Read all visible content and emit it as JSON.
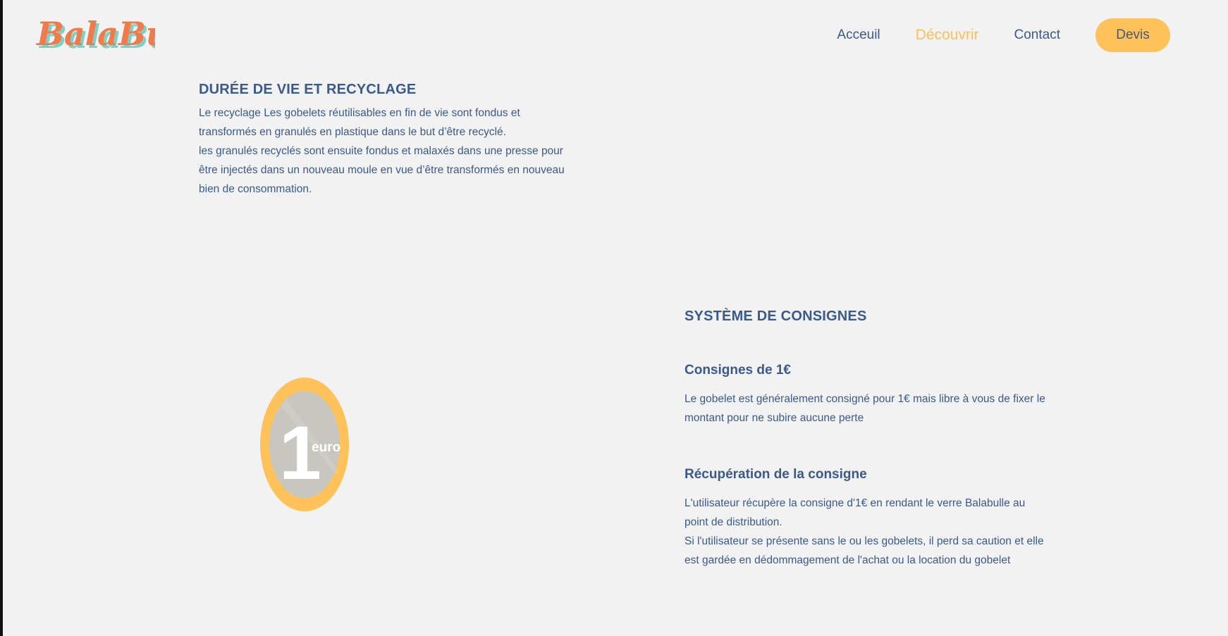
{
  "brand": {
    "logo_text": "BalaBulle"
  },
  "nav": {
    "items": [
      {
        "label": "Acceuil",
        "active": false
      },
      {
        "label": "Découvrir",
        "active": true
      },
      {
        "label": "Contact",
        "active": false
      }
    ],
    "cta_label": "Devis"
  },
  "section_recycling": {
    "title": "DURÉE DE VIE ET RECYCLAGE",
    "paragraph1": "Le recyclage Les gobelets réutilisables en fin de vie sont fondus et transformés en granulés en plastique dans le but d’être recyclé.",
    "paragraph2": "les granulés recyclés sont ensuite fondus et malaxés dans une presse pour être injectés dans un nouveau moule en vue d’être transformés en nouveau bien de consommation."
  },
  "coin": {
    "number": "1",
    "unit": "euro"
  },
  "section_deposit": {
    "title": "SYSTÈME DE CONSIGNES",
    "block1": {
      "heading": "Consignes de 1€",
      "text": "Le gobelet est généralement consigné pour 1€ mais libre à vous de fixer le montant pour ne subire aucune perte"
    },
    "block2": {
      "heading": "Récupération de la consigne",
      "text1": "L'utilisateur récupère la consigne d'1€ en rendant le verre Balabulle au point de distribution.",
      "text2": "Si l'utilisateur se présente sans le ou les gobelets, il perd sa caution et elle est gardée en dédommagement de l'achat ou la location du gobelet"
    }
  },
  "colors": {
    "text": "#3a5a8c",
    "accent": "#ffc15a",
    "background": "#f2f2f2",
    "coin_inner": "#c8c6c1",
    "logo_orange": "#f07a4a",
    "logo_teal": "#7fcfc4"
  }
}
